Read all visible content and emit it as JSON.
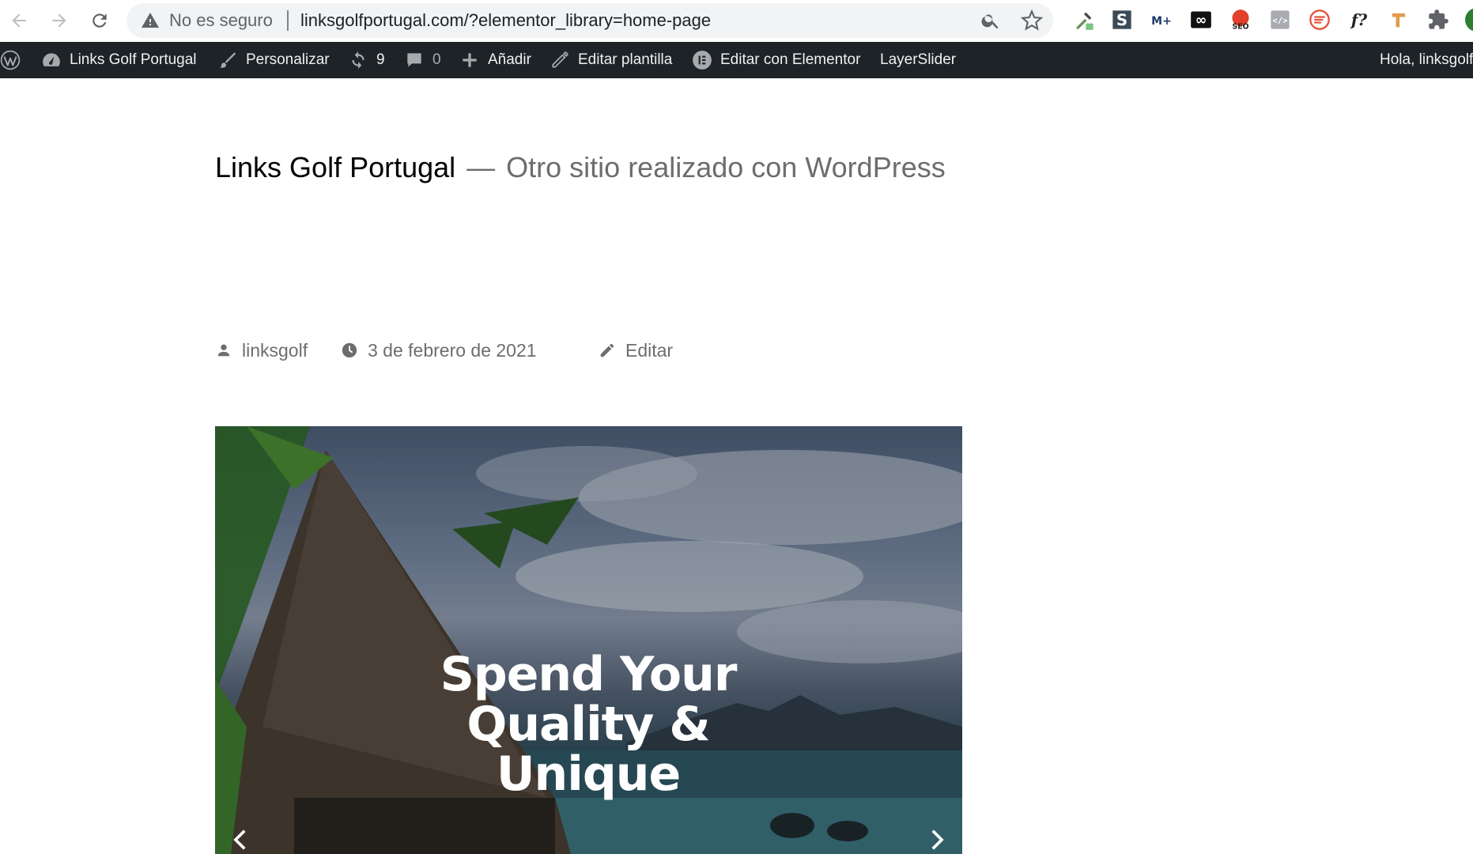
{
  "browser": {
    "security_label": "No es seguro",
    "url": "linksgolfportugal.com/?elementor_library=home-page",
    "icons": [
      "back-arrow-icon",
      "forward-arrow-icon",
      "reload-icon",
      "warning-icon",
      "zoom-icon",
      "bookmark-star-icon"
    ],
    "extensions": [
      {
        "name": "eyedropper-extension-icon"
      },
      {
        "name": "s-extension-icon",
        "label": "S"
      },
      {
        "name": "movistar-extension-icon",
        "label": "M+"
      },
      {
        "name": "infinity-extension-icon",
        "label": "∞"
      },
      {
        "name": "seo-extension-icon",
        "label": "SEO"
      },
      {
        "name": "code-extension-icon",
        "label": "</>"
      },
      {
        "name": "feed-extension-icon"
      },
      {
        "name": "font-extension-icon",
        "label": "f?"
      },
      {
        "name": "pipe-extension-icon"
      },
      {
        "name": "puzzle-extensions-icon"
      }
    ]
  },
  "adminbar": {
    "site_name": "Links Golf Portugal",
    "customize": "Personalizar",
    "updates_count": "9",
    "comments_count": "0",
    "add_new": "Añadir",
    "edit_template": "Editar plantilla",
    "edit_elementor": "Editar con Elementor",
    "layerslider": "LayerSlider",
    "greeting": "Hola, linksgolf"
  },
  "header": {
    "site_title": "Links Golf Portugal",
    "separator": "—",
    "tagline": "Otro sitio realizado con WordPress"
  },
  "meta": {
    "author": "linksgolf",
    "date": "3 de febrero de 2021",
    "edit": "Editar"
  },
  "slider": {
    "heading": "Spend Your Quality & Unique"
  },
  "colors": {
    "adminbar_bg": "#1d2327",
    "omnibox_bg": "#f1f3f4",
    "meta_text": "#6d6d6d"
  }
}
